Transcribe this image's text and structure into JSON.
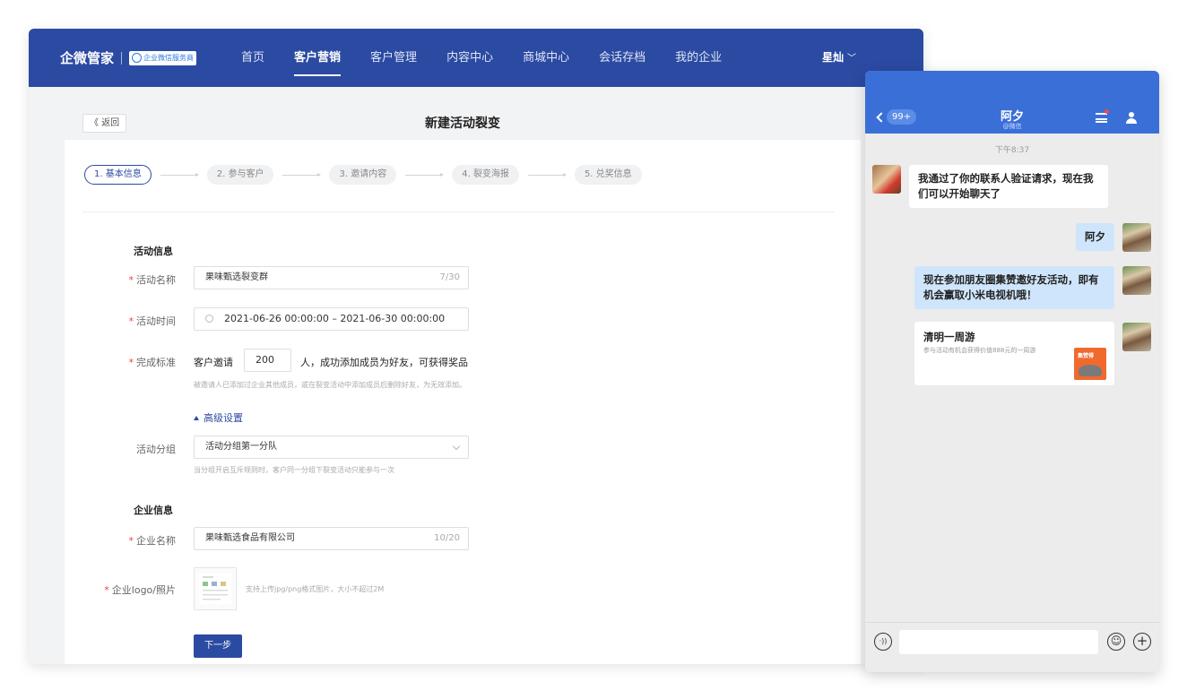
{
  "header": {
    "brand": "企微管家",
    "badge": "企业微信服务商",
    "nav": [
      "首页",
      "客户营销",
      "客户管理",
      "内容中心",
      "商城中心",
      "会话存档",
      "我的企业"
    ],
    "active_nav": "客户营销",
    "user": "星灿",
    "user_chevron": "﹀"
  },
  "page": {
    "back": "《 返回",
    "title": "新建活动裂变"
  },
  "steps": [
    "1. 基本信息",
    "2. 参与客户",
    "3. 邀请内容",
    "4. 裂变海报",
    "5. 兑奖信息"
  ],
  "form": {
    "section_activity": "活动信息",
    "name_label": "活动名称",
    "name_value": "果味甄选裂变群",
    "name_count": "7/30",
    "time_label": "活动时间",
    "time_value": "2021-06-26 00:00:00  –  2021-06-30 00:00:00",
    "standard_label": "完成标准",
    "standard_prefix": "客户邀请",
    "standard_value": "200",
    "standard_suffix": "人，成功添加成员为好友，可获得奖品",
    "standard_hint": "被邀请人已添加过企业其他成员，或在裂变活动中添加成员后删除好友，为无效添加。",
    "advanced": "高级设置",
    "group_label": "活动分组",
    "group_value": "活动分组第一分队",
    "group_hint": "当分组开启互斥规则时，客户同一分组下裂变活动只能参与一次",
    "section_company": "企业信息",
    "company_label": "企业名称",
    "company_value": "果味甄选食品有限公司",
    "company_count": "10/20",
    "logo_label": "企业logo/照片",
    "logo_hint": "支持上传jpg/png格式图片，大小不超过2M",
    "next": "下一步",
    "required_mark": "*"
  },
  "chat": {
    "unread": "99+",
    "name": "阿夕",
    "sub": "@微信",
    "time": "下午8:37",
    "messages": [
      {
        "from": "in",
        "text": "我通过了你的联系人验证请求，现在我们可以开始聊天了"
      },
      {
        "from": "out",
        "text": "阿夕"
      },
      {
        "from": "out",
        "text": "现在参加朋友圈集赞邀好友活动，即有机会赢取小米电视机哦！"
      }
    ],
    "card": {
      "title": "清明一周游",
      "desc": "参与活动有机会获得价值888元的一周游",
      "thumb_label": "集赞得"
    },
    "voice": "·))",
    "emoji": "☺",
    "plus": "+"
  }
}
